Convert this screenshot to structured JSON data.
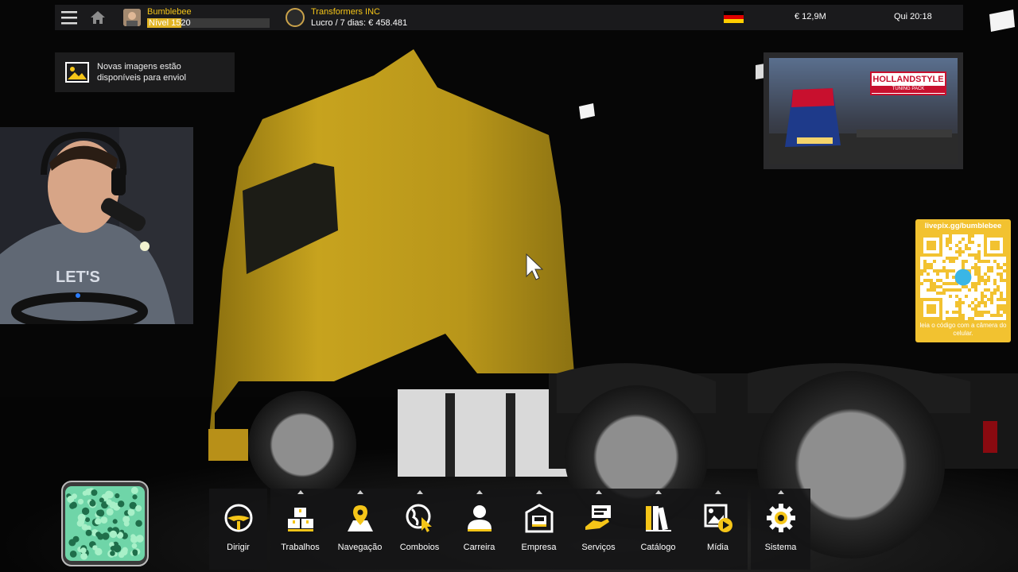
{
  "topbar": {
    "player_name": "Bumblebee",
    "player_level": "Nível 1520",
    "level_progress": 0.28,
    "company_name": "Transformers INC",
    "company_profit": "Lucro / 7 dias: € 458.481",
    "money": "€ 12,9M",
    "time": "Qui 20:18"
  },
  "notification": {
    "text": "Novas imagens estão disponíveis para enviol"
  },
  "ad": {
    "logo_main": "HOLLANDSTYLE",
    "logo_sub": "TUNING PACK"
  },
  "qr": {
    "url": "livepix.gg/bumblebee",
    "caption": "leia o código com a câmera do celular."
  },
  "webcam": {
    "shirt_text": "LET'S"
  },
  "menu": {
    "items": [
      {
        "label": "Dirigir",
        "icon": "steering-wheel-icon"
      },
      {
        "label": "Trabalhos",
        "icon": "cargo-boxes-icon"
      },
      {
        "label": "Navegação",
        "icon": "map-pin-icon"
      },
      {
        "label": "Comboios",
        "icon": "globe-cursor-icon"
      },
      {
        "label": "Carreira",
        "icon": "person-icon"
      },
      {
        "label": "Empresa",
        "icon": "garage-truck-icon"
      },
      {
        "label": "Serviços",
        "icon": "service-hand-icon"
      },
      {
        "label": "Catálogo",
        "icon": "books-icon"
      },
      {
        "label": "Mídia",
        "icon": "media-icon"
      },
      {
        "label": "Sistema",
        "icon": "gear-icon"
      }
    ]
  },
  "colors": {
    "accent": "#f5c518",
    "truck_yellow": "#c9a51c",
    "panel_bg": "#1c1c1e"
  }
}
